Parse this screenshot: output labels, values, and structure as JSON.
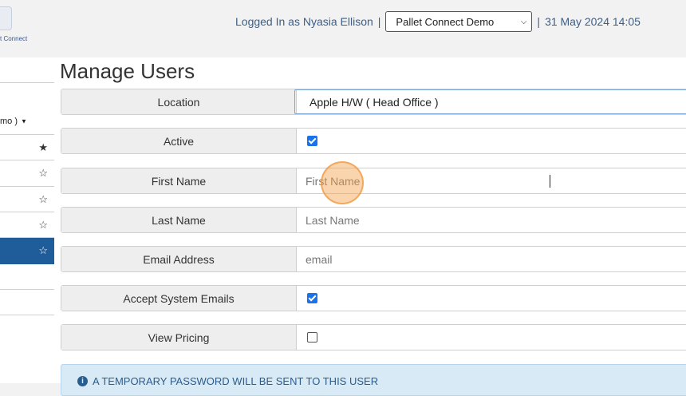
{
  "logo": {
    "text": "t Connect"
  },
  "header": {
    "logged_in_text": "Logged In as Nyasia Ellison",
    "separator_left": "|",
    "org_selected": "Pallet Connect Demo",
    "separator_right": "|",
    "datetime": "31 May 2024 14:05"
  },
  "sidebar": {
    "items": [
      {
        "label": "",
        "star": ""
      },
      {
        "label": "mo )",
        "star": ""
      },
      {
        "label": "",
        "star": "★"
      },
      {
        "label": "",
        "star": "☆"
      },
      {
        "label": "",
        "star": "☆"
      },
      {
        "label": "",
        "star": "☆"
      },
      {
        "label": "",
        "star": "☆",
        "active": true
      },
      {
        "label": "",
        "star": ""
      },
      {
        "label": "",
        "star": ""
      }
    ]
  },
  "page": {
    "title": "Manage Users"
  },
  "form": {
    "location": {
      "label": "Location",
      "value": "Apple H/W ( Head Office )"
    },
    "active": {
      "label": "Active",
      "checked": true
    },
    "first_name": {
      "label": "First Name",
      "placeholder": "First Name"
    },
    "last_name": {
      "label": "Last Name",
      "placeholder": "Last Name"
    },
    "email": {
      "label": "Email Address",
      "placeholder": "email"
    },
    "accept_emails": {
      "label": "Accept System Emails",
      "checked": true
    },
    "view_pricing": {
      "label": "View Pricing",
      "checked": false
    }
  },
  "alert": {
    "text": "A TEMPORARY PASSWORD WILL BE SENT TO THIS USER"
  },
  "colors": {
    "accent": "#1f5d9a",
    "checkbox": "#1a73e8",
    "alert_bg": "#d9eaf7"
  }
}
